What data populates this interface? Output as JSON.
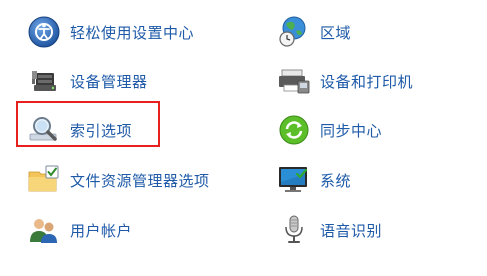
{
  "accent_color": "#1e5aa8",
  "highlight_color": "#e8201d",
  "items": [
    {
      "label": "轻松使用设置中心",
      "icon": "ease-of-access-icon"
    },
    {
      "label": "区域",
      "icon": "region-globe-clock-icon"
    },
    {
      "label": "设备管理器",
      "icon": "device-manager-icon"
    },
    {
      "label": "设备和打印机",
      "icon": "devices-printers-icon"
    },
    {
      "label": "索引选项",
      "icon": "indexing-options-icon",
      "highlighted": true
    },
    {
      "label": "同步中心",
      "icon": "sync-center-icon"
    },
    {
      "label": "文件资源管理器选项",
      "icon": "file-explorer-options-icon"
    },
    {
      "label": "系统",
      "icon": "system-monitor-icon"
    },
    {
      "label": "用户帐户",
      "icon": "user-accounts-icon"
    },
    {
      "label": "语音识别",
      "icon": "speech-recognition-icon"
    }
  ]
}
